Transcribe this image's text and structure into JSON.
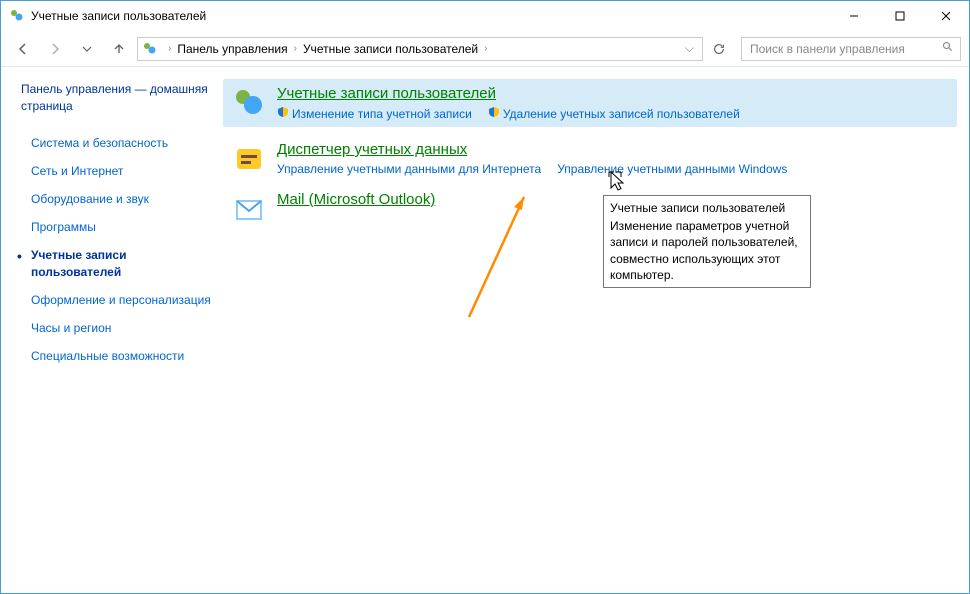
{
  "title": "Учетные записи пользователей",
  "breadcrumb": {
    "root": "Панель управления",
    "current": "Учетные записи пользователей"
  },
  "search": {
    "placeholder": "Поиск в панели управления"
  },
  "sidebar": {
    "home": "Панель управления — домашняя страница",
    "items": [
      {
        "label": "Система и безопасность",
        "active": false
      },
      {
        "label": "Сеть и Интернет",
        "active": false
      },
      {
        "label": "Оборудование и звук",
        "active": false
      },
      {
        "label": "Программы",
        "active": false
      },
      {
        "label": "Учетные записи пользователей",
        "active": true
      },
      {
        "label": "Оформление и персонализация",
        "active": false
      },
      {
        "label": "Часы и регион",
        "active": false
      },
      {
        "label": "Специальные возможности",
        "active": false
      }
    ]
  },
  "categories": [
    {
      "title": "Учетные записи пользователей",
      "highlighted": true,
      "links": [
        {
          "label": "Изменение типа учетной записи",
          "shield": true
        },
        {
          "label": "Удаление учетных записей пользователей",
          "shield": true
        }
      ]
    },
    {
      "title": "Диспетчер учетных данных",
      "highlighted": false,
      "links": [
        {
          "label": "Управление учетными данными для Интернета",
          "shield": false
        },
        {
          "label": "Управление учетными данными Windows",
          "shield": false
        }
      ]
    },
    {
      "title": "Mail (Microsoft Outlook)",
      "highlighted": false,
      "links": []
    }
  ],
  "tooltip": {
    "title": "Учетные записи пользователей",
    "body": "Изменение параметров учетной записи и паролей пользователей, совместно использующих этот компьютер."
  }
}
